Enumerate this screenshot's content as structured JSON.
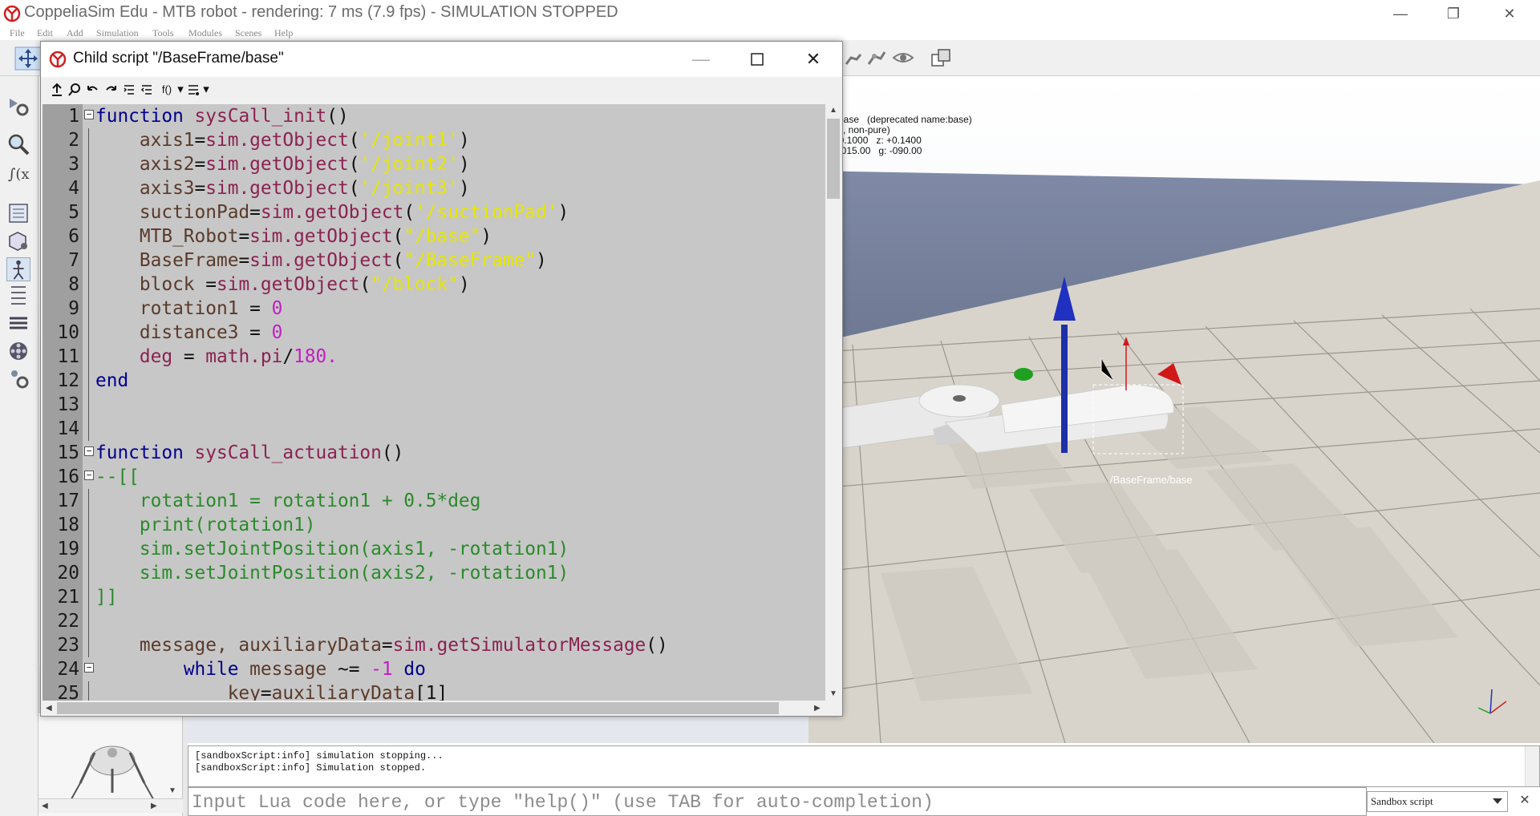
{
  "app": {
    "title": "CoppeliaSim Edu - MTB robot - rendering: 7 ms (7.9 fps) - SIMULATION STOPPED",
    "minimize": "—",
    "restore": "❐",
    "close": "✕"
  },
  "menu": [
    "File",
    "Edit",
    "Add",
    "Simulation",
    "Tools",
    "Modules",
    "Scenes",
    "Help"
  ],
  "viewport": {
    "object_info": "e/base   (deprecated name:base)\nble, non-pure)\n: -0.1000   z: +0.1400\n: +015.00   g: -090.00",
    "object_label": "/BaseFrame/base"
  },
  "editor": {
    "title": "Child script \"/BaseFrame/base\"",
    "toolbar": {
      "fx": "f()",
      "dropdown": "▾"
    },
    "lines": [
      {
        "n": "1",
        "fold": "−",
        "t": [
          [
            "kw",
            "function"
          ],
          [
            "op",
            " "
          ],
          [
            "fn",
            "sysCall_init"
          ],
          [
            "op",
            "()"
          ]
        ]
      },
      {
        "n": "2",
        "t": [
          [
            "op",
            "    "
          ],
          [
            "id",
            "axis1"
          ],
          [
            "op",
            "="
          ],
          [
            "fn",
            "sim.getObject"
          ],
          [
            "op",
            "("
          ],
          [
            "str",
            "'/joint1'"
          ],
          [
            "op",
            ")"
          ]
        ]
      },
      {
        "n": "3",
        "t": [
          [
            "op",
            "    "
          ],
          [
            "id",
            "axis2"
          ],
          [
            "op",
            "="
          ],
          [
            "fn",
            "sim.getObject"
          ],
          [
            "op",
            "("
          ],
          [
            "str",
            "'/joint2'"
          ],
          [
            "op",
            ")"
          ]
        ]
      },
      {
        "n": "4",
        "t": [
          [
            "op",
            "    "
          ],
          [
            "id",
            "axis3"
          ],
          [
            "op",
            "="
          ],
          [
            "fn",
            "sim.getObject"
          ],
          [
            "op",
            "("
          ],
          [
            "str",
            "'/joint3'"
          ],
          [
            "op",
            ")"
          ]
        ]
      },
      {
        "n": "5",
        "t": [
          [
            "op",
            "    "
          ],
          [
            "id",
            "suctionPad"
          ],
          [
            "op",
            "="
          ],
          [
            "fn",
            "sim.getObject"
          ],
          [
            "op",
            "("
          ],
          [
            "str",
            "'/suctionPad'"
          ],
          [
            "op",
            ")"
          ]
        ]
      },
      {
        "n": "6",
        "t": [
          [
            "op",
            "    "
          ],
          [
            "id",
            "MTB_Robot"
          ],
          [
            "op",
            "="
          ],
          [
            "fn",
            "sim.getObject"
          ],
          [
            "op",
            "("
          ],
          [
            "str",
            "\"/base\""
          ],
          [
            "op",
            ")"
          ]
        ]
      },
      {
        "n": "7",
        "t": [
          [
            "op",
            "    "
          ],
          [
            "id",
            "BaseFrame"
          ],
          [
            "op",
            "="
          ],
          [
            "fn",
            "sim.getObject"
          ],
          [
            "op",
            "("
          ],
          [
            "str",
            "\"/BaseFrame\""
          ],
          [
            "op",
            ")"
          ]
        ]
      },
      {
        "n": "8",
        "t": [
          [
            "op",
            "    "
          ],
          [
            "id",
            "block "
          ],
          [
            "op",
            "="
          ],
          [
            "fn",
            "sim.getObject"
          ],
          [
            "op",
            "("
          ],
          [
            "str",
            "\"/block\""
          ],
          [
            "op",
            ")"
          ]
        ]
      },
      {
        "n": "9",
        "t": [
          [
            "op",
            "    "
          ],
          [
            "id",
            "rotation1"
          ],
          [
            "op",
            " = "
          ],
          [
            "num",
            "0"
          ]
        ]
      },
      {
        "n": "10",
        "t": [
          [
            "op",
            "    "
          ],
          [
            "id",
            "distance3"
          ],
          [
            "op",
            " = "
          ],
          [
            "num",
            "0"
          ]
        ]
      },
      {
        "n": "11",
        "t": [
          [
            "op",
            "    "
          ],
          [
            "fn",
            "deg"
          ],
          [
            "op",
            " = "
          ],
          [
            "fn",
            "math.pi"
          ],
          [
            "op",
            "/"
          ],
          [
            "num",
            "180."
          ]
        ]
      },
      {
        "n": "12",
        "t": [
          [
            "kw",
            "end"
          ]
        ]
      },
      {
        "n": "13",
        "t": []
      },
      {
        "n": "14",
        "t": []
      },
      {
        "n": "15",
        "fold": "−",
        "t": [
          [
            "kw",
            "function"
          ],
          [
            "op",
            " "
          ],
          [
            "fn",
            "sysCall_actuation"
          ],
          [
            "op",
            "()"
          ]
        ]
      },
      {
        "n": "16",
        "fold": "−",
        "t": [
          [
            "cmt",
            "--[["
          ]
        ]
      },
      {
        "n": "17",
        "t": [
          [
            "cmt",
            "    rotation1 = rotation1 + 0.5*deg"
          ]
        ]
      },
      {
        "n": "18",
        "t": [
          [
            "cmt",
            "    print(rotation1)"
          ]
        ]
      },
      {
        "n": "19",
        "t": [
          [
            "cmt",
            "    sim.setJointPosition(axis1, -rotation1)"
          ]
        ]
      },
      {
        "n": "20",
        "t": [
          [
            "cmt",
            "    sim.setJointPosition(axis2, -rotation1)"
          ]
        ]
      },
      {
        "n": "21",
        "t": [
          [
            "cmt",
            "]]"
          ]
        ]
      },
      {
        "n": "22",
        "t": []
      },
      {
        "n": "23",
        "t": [
          [
            "op",
            "    "
          ],
          [
            "id",
            "message, auxiliaryData"
          ],
          [
            "op",
            "="
          ],
          [
            "fn",
            "sim.getSimulatorMessage"
          ],
          [
            "op",
            "()"
          ]
        ]
      },
      {
        "n": "24",
        "fold": "−",
        "t": [
          [
            "op",
            "        "
          ],
          [
            "kw",
            "while"
          ],
          [
            "op",
            " "
          ],
          [
            "id",
            "message"
          ],
          [
            "op",
            " ~= "
          ],
          [
            "num",
            "-1"
          ],
          [
            "op",
            " "
          ],
          [
            "kw",
            "do"
          ]
        ]
      },
      {
        "n": "25",
        "t": [
          [
            "op",
            "            "
          ],
          [
            "id",
            "key"
          ],
          [
            "op",
            "="
          ],
          [
            "id",
            "auxiliaryData"
          ],
          [
            "op",
            "[1]"
          ]
        ]
      }
    ]
  },
  "console": {
    "lines": [
      "[sandboxScript:info] simulation stopping...",
      "[sandboxScript:info] Simulation stopped."
    ],
    "input_placeholder": "Input Lua code here, or type \"help()\" (use TAB for auto-completion)",
    "sandbox_selected": "Sandbox script",
    "close": "✕"
  },
  "colors": {
    "keyword": "#00008b",
    "function": "#8b2252",
    "string": "#e6e600",
    "number": "#c020c0",
    "comment": "#2a8a2a",
    "code_bg": "#c7c7c7",
    "gutter_bg": "#9f9f9f"
  }
}
